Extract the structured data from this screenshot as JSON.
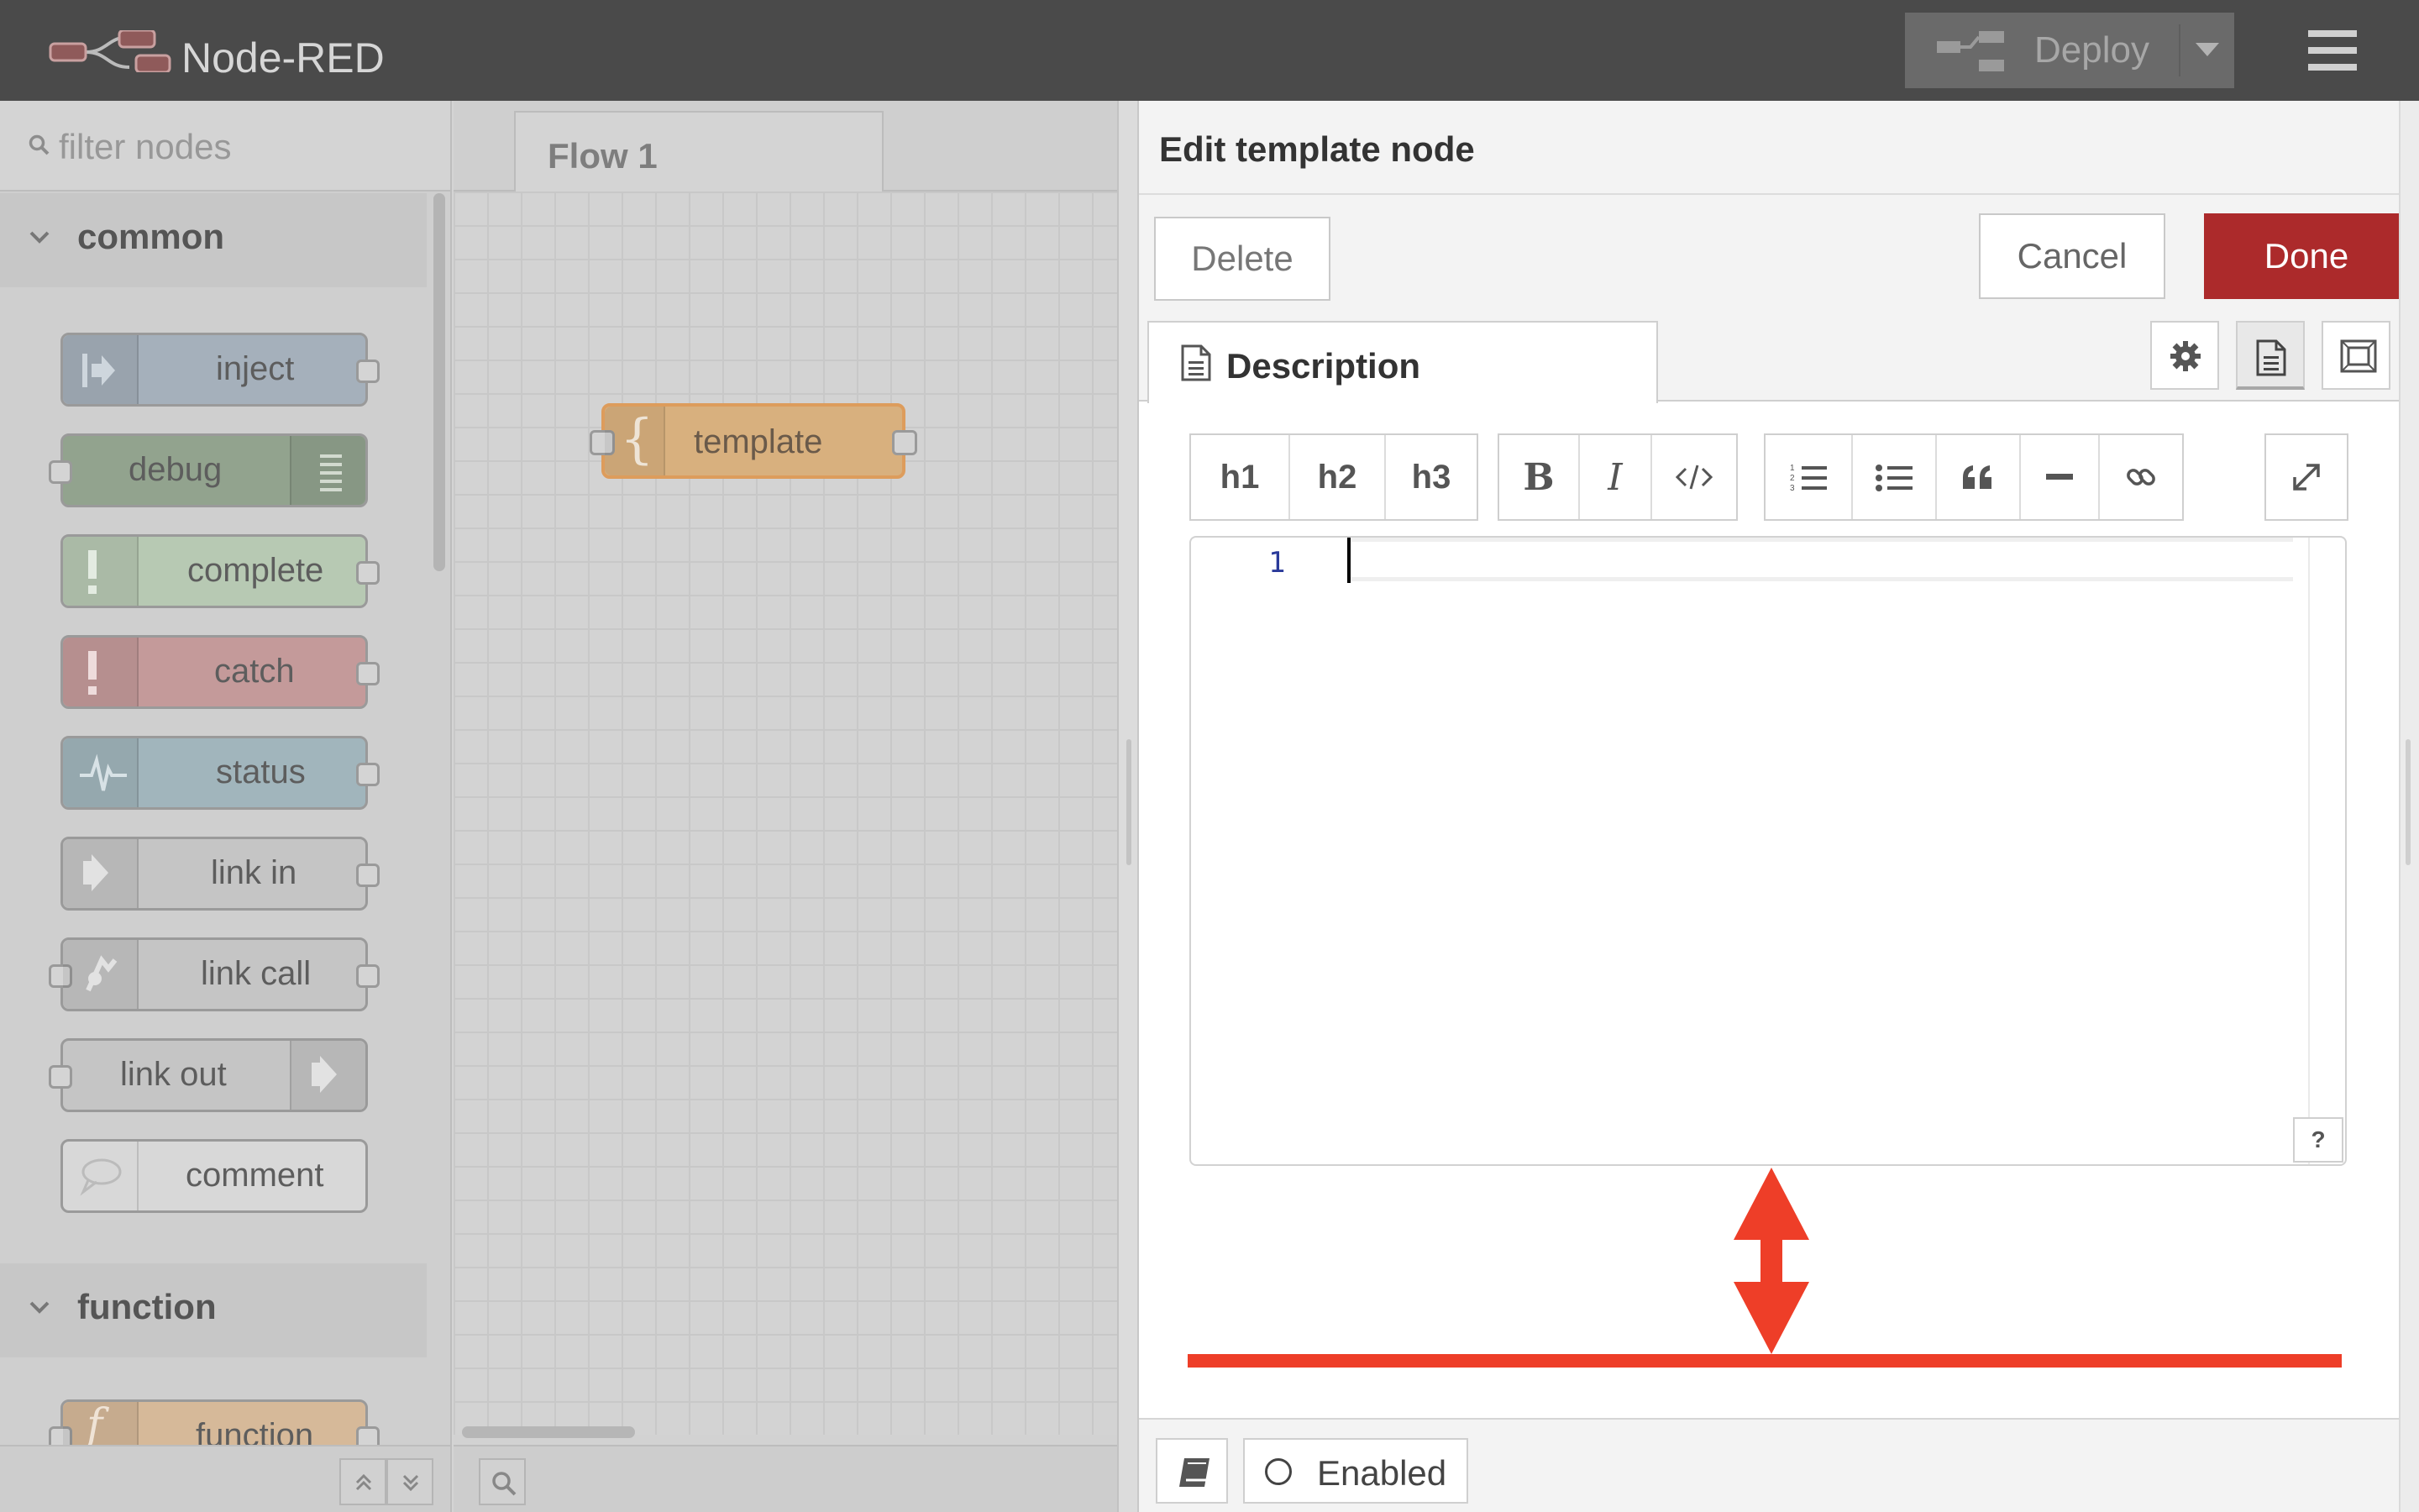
{
  "header": {
    "title": "Node-RED",
    "deploy_label": "Deploy"
  },
  "palette": {
    "search_placeholder": "filter nodes",
    "categories": [
      {
        "label": "common",
        "nodes": [
          {
            "label": "inject",
            "color": "#a6bbcf"
          },
          {
            "label": "debug",
            "color": "#87a980"
          },
          {
            "label": "complete",
            "color": "#c0deed"
          },
          {
            "label": "catch",
            "color": "#e49191"
          },
          {
            "label": "status",
            "color": "#94c1d0"
          },
          {
            "label": "link in",
            "color": "#dddddd"
          },
          {
            "label": "link call",
            "color": "#dddddd"
          },
          {
            "label": "link out",
            "color": "#dddddd"
          },
          {
            "label": "comment",
            "color": "#ffffff"
          }
        ]
      },
      {
        "label": "function",
        "nodes": [
          {
            "label": "function",
            "color": "#fdd0a2"
          }
        ]
      }
    ]
  },
  "workspace": {
    "tab_label": "Flow 1",
    "node": {
      "label": "template",
      "icon_glyph": "{",
      "color": "#d8b07e"
    }
  },
  "tray": {
    "title": "Edit template node",
    "delete_label": "Delete",
    "cancel_label": "Cancel",
    "done_label": "Done",
    "tab_label": "Description",
    "toolbar": {
      "headings": [
        "h1",
        "h2",
        "h3"
      ],
      "format_icons": [
        "bold-icon",
        "italic-icon",
        "code-icon"
      ],
      "block_icons": [
        "ordered-list-icon",
        "bullet-list-icon",
        "quote-icon",
        "horizontal-rule-icon",
        "link-icon"
      ],
      "bold_glyph": "B",
      "italic_glyph": "I"
    },
    "editor": {
      "line_number": "1",
      "help_label": "?"
    },
    "footer": {
      "enabled_label": "Enabled"
    }
  },
  "colors": {
    "done_button": "#ac2a2b",
    "annotation": "#ee3e28",
    "header": "#4a4a4a"
  }
}
